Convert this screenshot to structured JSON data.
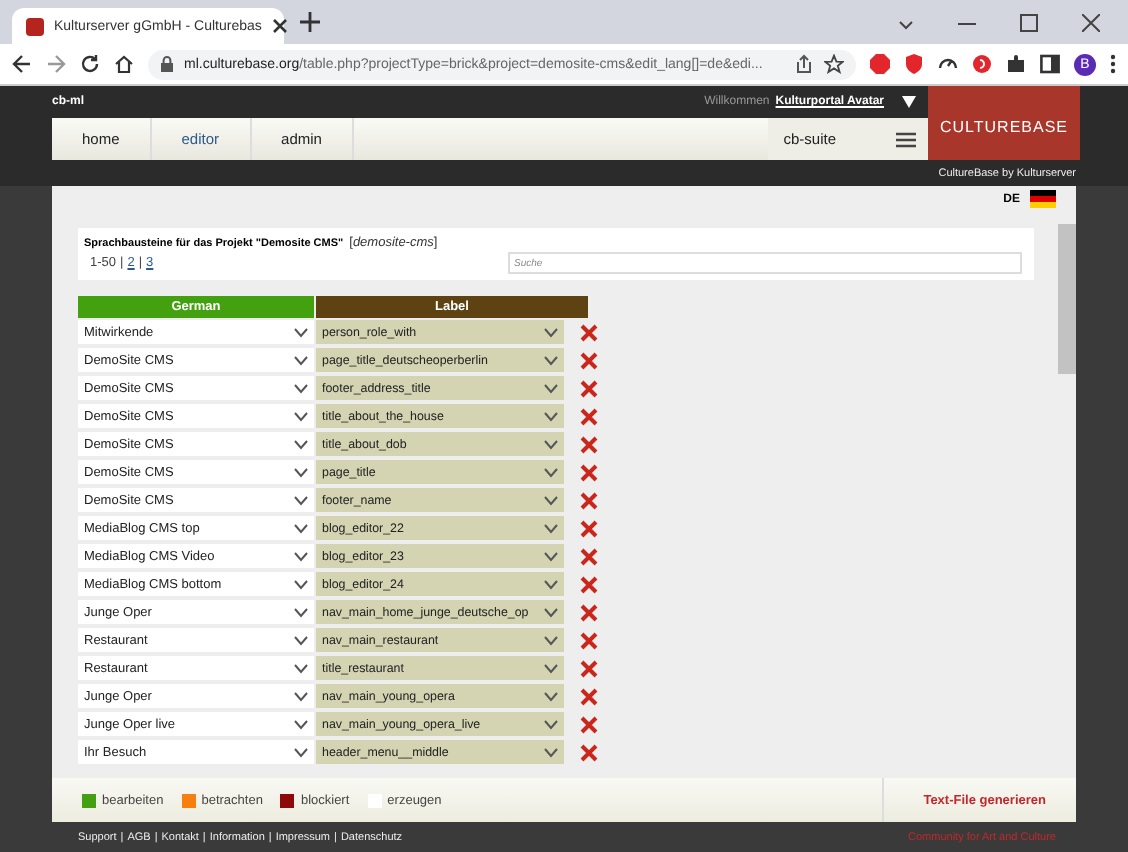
{
  "browser": {
    "tab_title": "Kulturserver gGmbH - Culturebas",
    "url_host": "ml.culturebase.org",
    "url_path": "/table.php?projectType=brick&project=demosite-cms&edit_lang[]=de&edi...",
    "profile": "B"
  },
  "header": {
    "site": "cb-ml",
    "welcome": "Willkommen",
    "user": "Kulturportal Avatar",
    "nav": [
      {
        "label": "home",
        "selected": false
      },
      {
        "label": "editor",
        "selected": true
      },
      {
        "label": "admin",
        "selected": false
      }
    ],
    "suite": "cb-suite",
    "logo": "CULTUREBASE",
    "tagline": "CultureBase by Kulturserver",
    "language": "DE"
  },
  "panel": {
    "title": "Sprachbausteine für das Projekt \"Demosite CMS\"",
    "project": "[*demosite-cms*]",
    "page_separator": "|",
    "pages": [
      {
        "label": "1-50",
        "selected": true
      },
      {
        "label": "2",
        "selected": false
      },
      {
        "label": "3",
        "selected": false
      }
    ],
    "search": {
      "placeholder": "Suche"
    }
  },
  "table": {
    "columns": [
      "German",
      "Label"
    ],
    "rows": [
      {
        "german": "Mitwirkende",
        "label": "person_role_with"
      },
      {
        "german": "DemoSite CMS",
        "label": "page_title_deutscheoperberlin"
      },
      {
        "german": "DemoSite CMS",
        "label": "footer_address_title"
      },
      {
        "german": "DemoSite CMS",
        "label": "title_about_the_house"
      },
      {
        "german": "DemoSite CMS",
        "label": "title_about_dob"
      },
      {
        "german": "DemoSite CMS",
        "label": "page_title"
      },
      {
        "german": "DemoSite CMS",
        "label": "footer_name"
      },
      {
        "german": "MediaBlog CMS top",
        "label": "blog_editor_22"
      },
      {
        "german": "MediaBlog CMS Video",
        "label": "blog_editor_23"
      },
      {
        "german": "MediaBlog CMS bottom",
        "label": "blog_editor_24"
      },
      {
        "german": "Junge Oper",
        "label": "nav_main_home_junge_deutsche_op"
      },
      {
        "german": "Restaurant",
        "label": "nav_main_restaurant"
      },
      {
        "german": "Restaurant",
        "label": "title_restaurant"
      },
      {
        "german": "Junge Oper",
        "label": "nav_main_young_opera"
      },
      {
        "german": "Junge Oper live",
        "label": "nav_main_young_opera_live"
      },
      {
        "german": "Ihr  Besuch",
        "label": "header_menu__middle"
      }
    ]
  },
  "legend": [
    {
      "label": "bearbeiten",
      "color": "#44a012"
    },
    {
      "label": "betrachten",
      "color": "#f57f0f"
    },
    {
      "label": "blockiert",
      "color": "#8e0a0a"
    },
    {
      "label": "erzeugen",
      "color": "#ffffff"
    }
  ],
  "generate_button": "Text-File generieren",
  "footer": {
    "separator": "|",
    "links": [
      "Support",
      "AGB",
      "Kontakt",
      "Information",
      "Impressum",
      "Datenschutz"
    ],
    "slogan": "Community for Art and Culture"
  }
}
